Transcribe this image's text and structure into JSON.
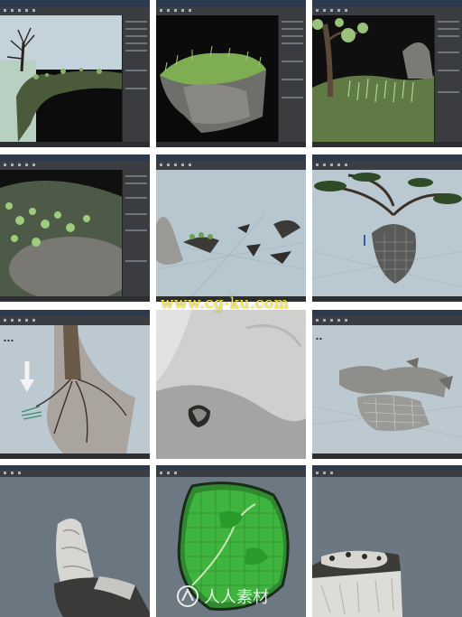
{
  "gallery": {
    "columns": 3,
    "rows": 4,
    "panels": [
      {
        "id": "p1",
        "scene": "tree-cliff-sky",
        "icon": "tree-scene-icon"
      },
      {
        "id": "p2",
        "scene": "floating-rock-grass",
        "icon": "rock-scene-icon"
      },
      {
        "id": "p3",
        "scene": "tree-closeup-grass",
        "icon": "tree-scene-icon"
      },
      {
        "id": "p4",
        "scene": "rock-moss-closeup",
        "icon": "rock-scene-icon"
      },
      {
        "id": "p5",
        "scene": "islands-perspective",
        "icon": "grid-scene-icon"
      },
      {
        "id": "p6",
        "scene": "tree-wireframe-rock",
        "icon": "grid-scene-icon"
      },
      {
        "id": "p7",
        "scene": "roots-arrow",
        "icon": "arrow-scene-icon"
      },
      {
        "id": "p8",
        "scene": "rock-sculpt-closeup",
        "icon": "sculpt-scene-icon"
      },
      {
        "id": "p9",
        "scene": "rock-fragments-grid",
        "icon": "grid-scene-icon"
      },
      {
        "id": "p10",
        "scene": "rock-pillar-sculpt",
        "icon": "sculpt-scene-icon"
      },
      {
        "id": "p11",
        "scene": "green-uv-mesh",
        "icon": "mesh-scene-icon"
      },
      {
        "id": "p12",
        "scene": "rock-slab-sculpt",
        "icon": "sculpt-scene-icon"
      }
    ]
  },
  "watermark": {
    "text": "www.cg-ku.com",
    "color": "#ffef3c"
  },
  "logo": {
    "text": "人人素材",
    "color": "#ffffff"
  },
  "colors": {
    "titlebar": "#2b3a4f",
    "panel_bg": "#3a3c40",
    "viewport_grey": "#6c7680",
    "grass_green": "#7fae52",
    "mesh_green": "#39b03a"
  }
}
